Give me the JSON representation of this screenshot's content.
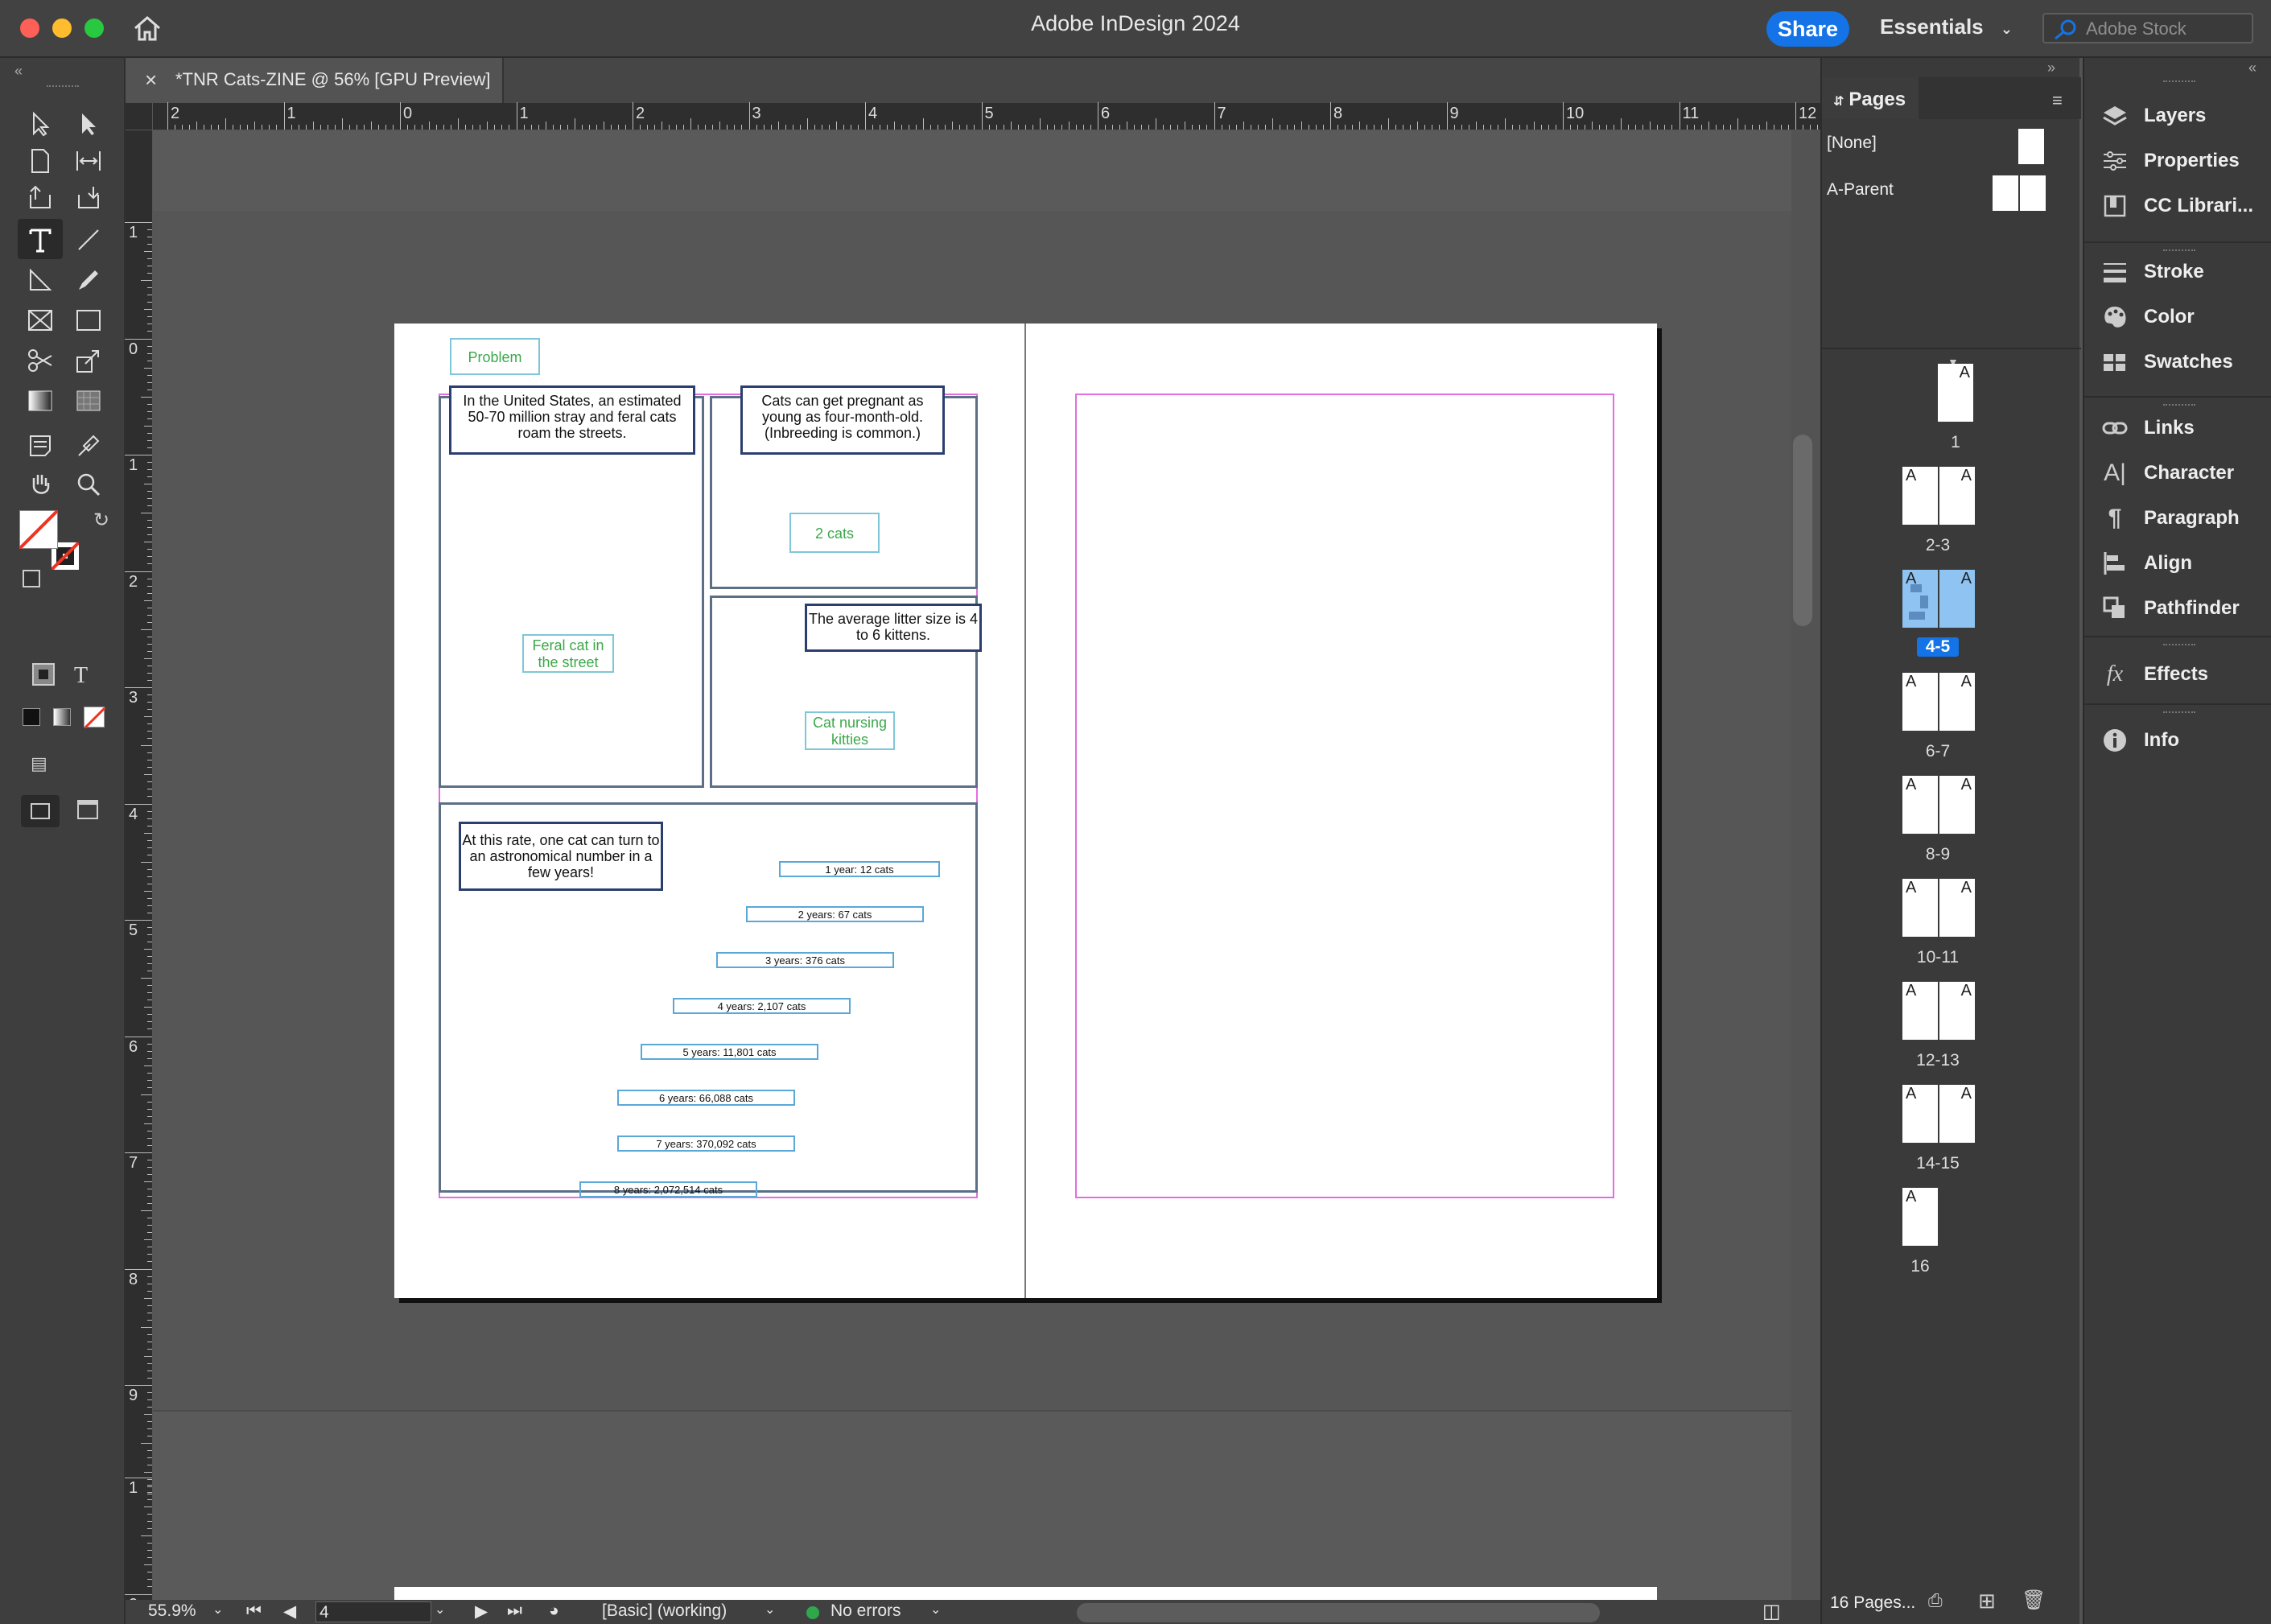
{
  "app": {
    "title": "Adobe InDesign 2024",
    "share_label": "Share",
    "workspace_label": "Essentials",
    "stock_placeholder": "Adobe Stock"
  },
  "document": {
    "tab_title": "*TNR Cats-ZINE @ 56% [GPU Preview]"
  },
  "rulers": {
    "horizontal": [
      "2",
      "1",
      "0",
      "1",
      "2",
      "3",
      "4",
      "5",
      "6",
      "7",
      "8",
      "9",
      "10",
      "11",
      "12"
    ],
    "vertical": [
      "1",
      "0",
      "1",
      "2",
      "3",
      "4",
      "5",
      "6",
      "7",
      "8",
      "9"
    ],
    "vertical_lower": [
      "1",
      "0"
    ]
  },
  "page_content": {
    "problem_label": "Problem",
    "us_stat": "In the United States, an estimated 50-70 million stray and feral cats roam the streets.",
    "pregnancy_fact": "Cats can get pregnant as young as four-month-old. (Inbreeding is common.)",
    "two_cats": "2 cats",
    "feral_cat": "Feral cat in the street",
    "litter_fact": "The average litter size is 4 to 6 kittens.",
    "nursing": "Cat nursing kitties",
    "rate_text": "At this rate, one cat can turn to an astronomical number in a few years!",
    "growth": [
      "1 year: 12 cats",
      "2 years: 67 cats",
      "3 years: 376 cats",
      "4 years: 2,107 cats",
      "5 years: 11,801 cats",
      "6 years: 66,088 cats",
      "7 years: 370,092 cats",
      "8 years: 2,072,514 cats"
    ]
  },
  "status": {
    "zoom": "55.9%",
    "page_field": "4",
    "preflight_profile": "[Basic] (working)",
    "preflight_status": "No errors"
  },
  "pages_panel": {
    "tab_label": "Pages",
    "parents": [
      "[None]",
      "A-Parent"
    ],
    "spreads": [
      "1",
      "2-3",
      "4-5",
      "6-7",
      "8-9",
      "10-11",
      "12-13",
      "14-15",
      "16"
    ],
    "selected_spread": "4-5",
    "page_letter": "A",
    "footer_label": "16 Pages..."
  },
  "dock": {
    "items": [
      "Layers",
      "Properties",
      "CC Librari...",
      "Stroke",
      "Color",
      "Swatches",
      "Links",
      "Character",
      "Paragraph",
      "Align",
      "Pathfinder",
      "Effects",
      "Info"
    ]
  },
  "colors": {
    "accent": "#1473e6",
    "selection": "#8fc3f2",
    "frame_stroke": "#5b6f85",
    "text_frame": "#2a3f70",
    "green_text": "#3ba84a",
    "margin_guide": "#e36de0"
  }
}
